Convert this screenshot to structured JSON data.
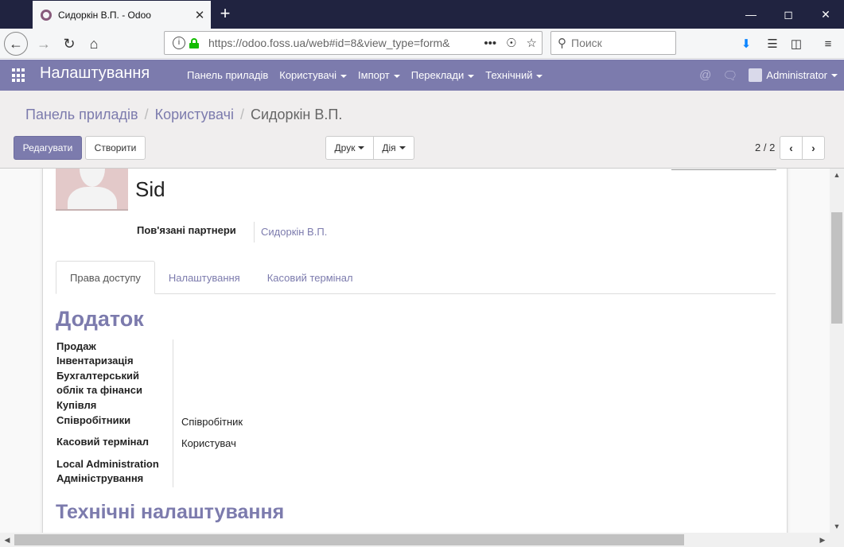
{
  "browser": {
    "tab_title": "Сидоркін В.П. - Odoo",
    "tab_close": "✕",
    "new_tab": "+",
    "url": "https://odoo.foss.ua/web#id=8&view_type=form&",
    "search_placeholder": "Поиск",
    "icons": [
      "back-icon",
      "forward-icon",
      "reload-icon",
      "home-icon",
      "info-icon",
      "lock-icon",
      "more-icon",
      "pocket-icon",
      "star-icon",
      "search-icon",
      "download-icon",
      "library-icon",
      "sidebar-icon",
      "menu-icon"
    ]
  },
  "topbar": {
    "app_title": "Налаштування",
    "menu": [
      {
        "label": "Панель приладів",
        "dropdown": false
      },
      {
        "label": "Користувачі",
        "dropdown": true
      },
      {
        "label": "Імпорт",
        "dropdown": true
      },
      {
        "label": "Переклади",
        "dropdown": true
      },
      {
        "label": "Технічний",
        "dropdown": true
      }
    ],
    "user": "Administrator",
    "accent": "#7c7bad"
  },
  "control_panel": {
    "breadcrumb": [
      "Панель приладів",
      "Користувачі",
      "Сидоркін В.П."
    ],
    "edit_label": "Редагувати",
    "create_label": "Створити",
    "print_label": "Друк",
    "action_label": "Дія",
    "pager": "2 / 2"
  },
  "form": {
    "login": "Sid",
    "related_partner_label": "Пов'язані партнери",
    "related_partner_value": "Сидоркін В.П.",
    "tabs": [
      "Права доступу",
      "Налаштування",
      "Касовий термінал"
    ],
    "active_tab": 0,
    "section_app_title": "Додаток",
    "permissions": [
      {
        "label": "Продаж",
        "value": ""
      },
      {
        "label": "Інвентаризація",
        "value": ""
      },
      {
        "label": "Бухгалтерський облік та фінанси",
        "value": ""
      },
      {
        "label": "Купівля",
        "value": ""
      },
      {
        "label": "Співробітники",
        "value": "Співробітник"
      },
      {
        "label": "Касовий термінал",
        "value": "Користувач"
      },
      {
        "label": "Local Administration Адміністрування",
        "value": ""
      }
    ],
    "section_tech_title": "Технічні налаштування"
  }
}
